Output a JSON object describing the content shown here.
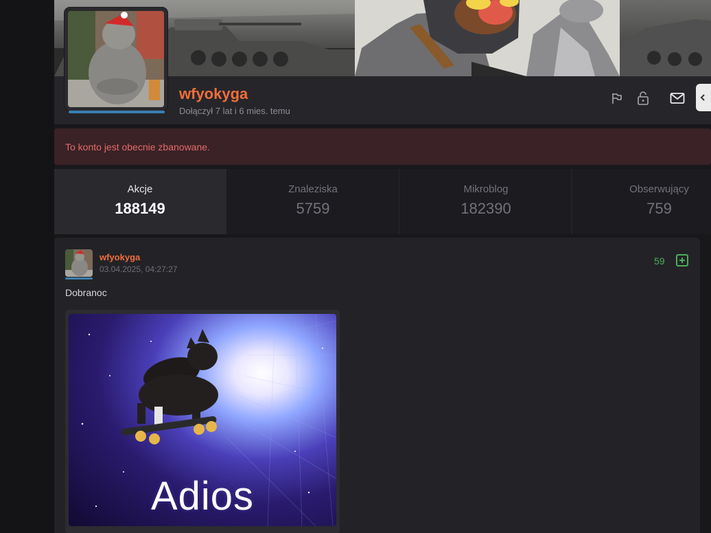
{
  "profile": {
    "username": "wfyokyga",
    "joined": "Dołączył 7 lat i 6 mies. temu",
    "actions": [
      {
        "icon": "flag-icon"
      },
      {
        "icon": "unlock-icon"
      },
      {
        "icon": "mail-icon"
      }
    ]
  },
  "notice": {
    "text": "To konto jest obecnie zbanowane."
  },
  "stats": [
    {
      "label": "Akcje",
      "value": "188149",
      "active": true
    },
    {
      "label": "Znaleziska",
      "value": "5759",
      "active": false
    },
    {
      "label": "Mikroblog",
      "value": "182390",
      "active": false
    },
    {
      "label": "Obserwujący",
      "value": "759",
      "active": false
    }
  ],
  "post": {
    "author": "wfyokyga",
    "date": "03.04.2025, 04:27:27",
    "votes": "59",
    "body": "Dobranoc",
    "image_caption": "Adios"
  },
  "colors": {
    "accent": "#f06e3a",
    "vote_green": "#4cae5a",
    "banned_text": "#e46a6a",
    "underline_blue": "#3a7fb0"
  }
}
